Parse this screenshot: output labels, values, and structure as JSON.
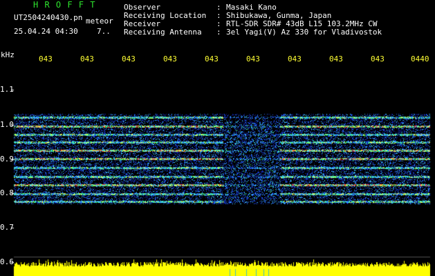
{
  "header": {
    "brand": "H R O F F T",
    "filename": "UT2504240430.pn",
    "kind_label": "meteor",
    "datetime": "25.04.24 04:30",
    "count": "7..",
    "fields": [
      {
        "label": "Observer",
        "sep": ":",
        "value": "Masaki Kano"
      },
      {
        "label": "Receiving Location",
        "sep": ":",
        "value": "Shibukawa, Gunma, Japan"
      },
      {
        "label": "Receiver",
        "sep": ":",
        "value": "RTL-SDR SDR# 43dB L15 103.2MHz CW"
      },
      {
        "label": "Receiving Antenna",
        "sep": ":",
        "value": "3el Yagi(V) Az 330 for Vladivostok"
      }
    ]
  },
  "axes": {
    "y_unit": "kHz",
    "y_ticks": [
      "1.1",
      "1.0",
      "0.9",
      "0.8",
      "0.7",
      "0.6"
    ],
    "time_ticks": [
      "043",
      "043",
      "043",
      "043",
      "043",
      "043",
      "043",
      "043",
      "043",
      "0440"
    ]
  },
  "colors": {
    "brand": "#2ee52e",
    "header_text": "#ffffff",
    "axis_text": "#ffffff",
    "time_text": "#ffff33",
    "signal_bar": "#ffff00",
    "background": "#000000"
  }
}
